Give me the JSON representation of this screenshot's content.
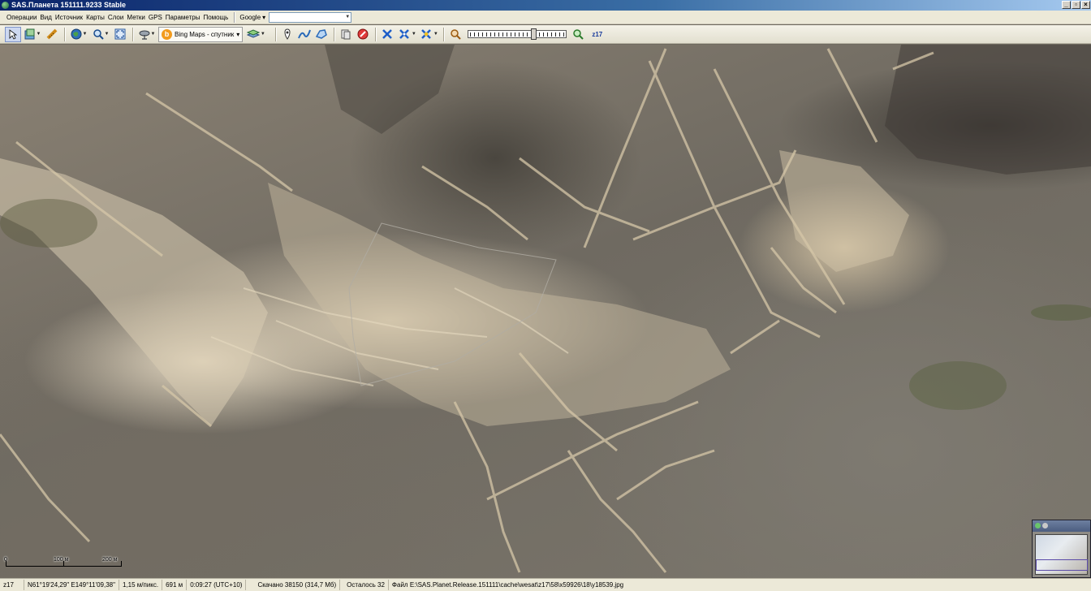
{
  "window": {
    "title": "SAS.Планета 151111.9233 Stable",
    "controls": [
      "_",
      "▫",
      "×"
    ]
  },
  "menu": {
    "items": [
      "Операции",
      "Вид",
      "Источник",
      "Карты",
      "Слои",
      "Метки",
      "GPS",
      "Параметры",
      "Помощь"
    ],
    "search_engine": "Google",
    "search_value": ""
  },
  "toolbar": {
    "map_source": "Bing Maps - спутник",
    "zoom_label": "z17",
    "zoom_level_fraction": 0.68
  },
  "map": {
    "scale": {
      "zero": "0",
      "mid": "100 м",
      "end": "200 м"
    }
  },
  "status": {
    "zoom": "z17",
    "coords": "N61°19'24,29\" E149°11'09,38\"",
    "resolution": "1,15 м/пикс.",
    "elevation": "691 м",
    "time": "0:09:27 (UTC+10)",
    "downloaded": "Скачано 38150 (314,7 Мб)",
    "remaining": "Осталось 32",
    "file": "Файл E:\\SAS.Planet.Release.151111\\cache\\wesat\\z17\\58\\x59926\\18\\y18539.jpg"
  },
  "colors": {
    "titlebar": "#0a246a",
    "accent": "#1a3c9c",
    "terrain_light": "#d8cbb2",
    "terrain_dark": "#4a463f"
  },
  "icons": [
    "app-icon",
    "arrow-cursor-icon",
    "layers-icon",
    "ruler-icon",
    "globe-icon",
    "zoom-icon",
    "fullscreen-icon",
    "satellite-dish-icon",
    "bing-icon",
    "map-layers-icon",
    "placemark-icon",
    "path-icon",
    "polygon-icon",
    "mark-edit-icon",
    "cancel-icon",
    "gps-icon",
    "gps-track-icon",
    "gps-center-icon",
    "zoom-out-icon",
    "zoom-in-icon"
  ]
}
